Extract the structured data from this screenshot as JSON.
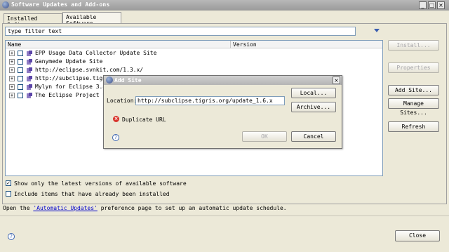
{
  "window": {
    "title": "Software Updates and Add-ons",
    "controls": {
      "minimize": "_",
      "maximize": "□",
      "close": "×"
    }
  },
  "tabs": [
    {
      "label": "Installed Software",
      "active": false
    },
    {
      "label": "Available Software",
      "active": true
    }
  ],
  "filter": {
    "value": "type filter text"
  },
  "table": {
    "columns": [
      "Name",
      "Version"
    ],
    "rows": [
      {
        "name": "EPP Usage Data Collector Update Site"
      },
      {
        "name": "Ganymede Update Site"
      },
      {
        "name": "http://eclipse.svnkit.com/1.3.x/"
      },
      {
        "name": "http://subclipse.tigris"
      },
      {
        "name": "Mylyn for Eclipse 3.4 a"
      },
      {
        "name": "The Eclipse Project Upd"
      }
    ]
  },
  "side_buttons": {
    "install": "Install...",
    "properties": "Properties",
    "add_site": "Add Site...",
    "manage_sites": "Manage Sites...",
    "refresh": "Refresh"
  },
  "options": {
    "latest_only": {
      "label": "Show only the latest versions of available software",
      "checked": true
    },
    "include_installed": {
      "label": "Include items that have already been installed",
      "checked": false
    }
  },
  "footer": {
    "text_before": "Open the ",
    "link": "'Automatic Updates'",
    "text_after": " preference page to set up an automatic update schedule.",
    "close": "Close"
  },
  "dialog": {
    "title": "Add Site",
    "location_label": "Location:",
    "location_value": "http://subclipse.tigris.org/update_1.6.x",
    "local_button": "Local...",
    "archive_button": "Archive...",
    "error_text": "Duplicate URL",
    "ok_button": "OK",
    "cancel_button": "Cancel",
    "close": "×"
  },
  "icons": {
    "error": "×",
    "help": "?",
    "check": "✓",
    "expand": "+"
  },
  "colors": {
    "dialog_bg": "#ece9d8",
    "link": "#0000cc",
    "error": "#d8332c"
  }
}
